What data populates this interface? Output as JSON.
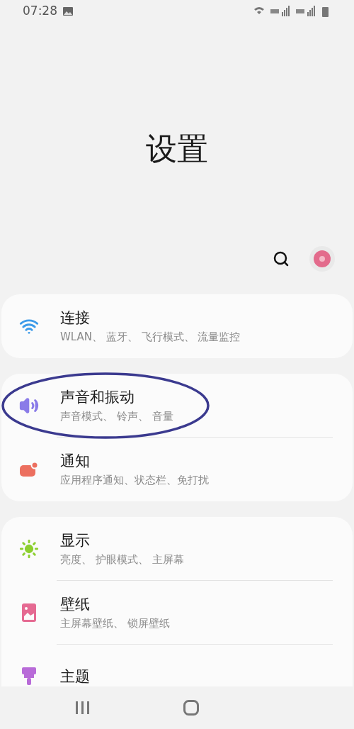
{
  "status_bar": {
    "time": "07:28"
  },
  "title": "设置",
  "groups": [
    {
      "items": [
        {
          "kind": "wifi",
          "title": "连接",
          "subtitle": "WLAN、 蓝牙、 飞行模式、 流量监控"
        }
      ]
    },
    {
      "items": [
        {
          "kind": "sound",
          "title": "声音和振动",
          "subtitle": "声音模式、 铃声、 音量"
        },
        {
          "kind": "notification",
          "title": "通知",
          "subtitle": "应用程序通知、状态栏、免打扰"
        }
      ]
    },
    {
      "items": [
        {
          "kind": "display",
          "title": "显示",
          "subtitle": "亮度、 护眼模式、 主屏幕"
        },
        {
          "kind": "wallpaper",
          "title": "壁纸",
          "subtitle": "主屏幕壁纸、 锁屏壁纸"
        },
        {
          "kind": "theme",
          "title": "主题"
        }
      ]
    }
  ]
}
